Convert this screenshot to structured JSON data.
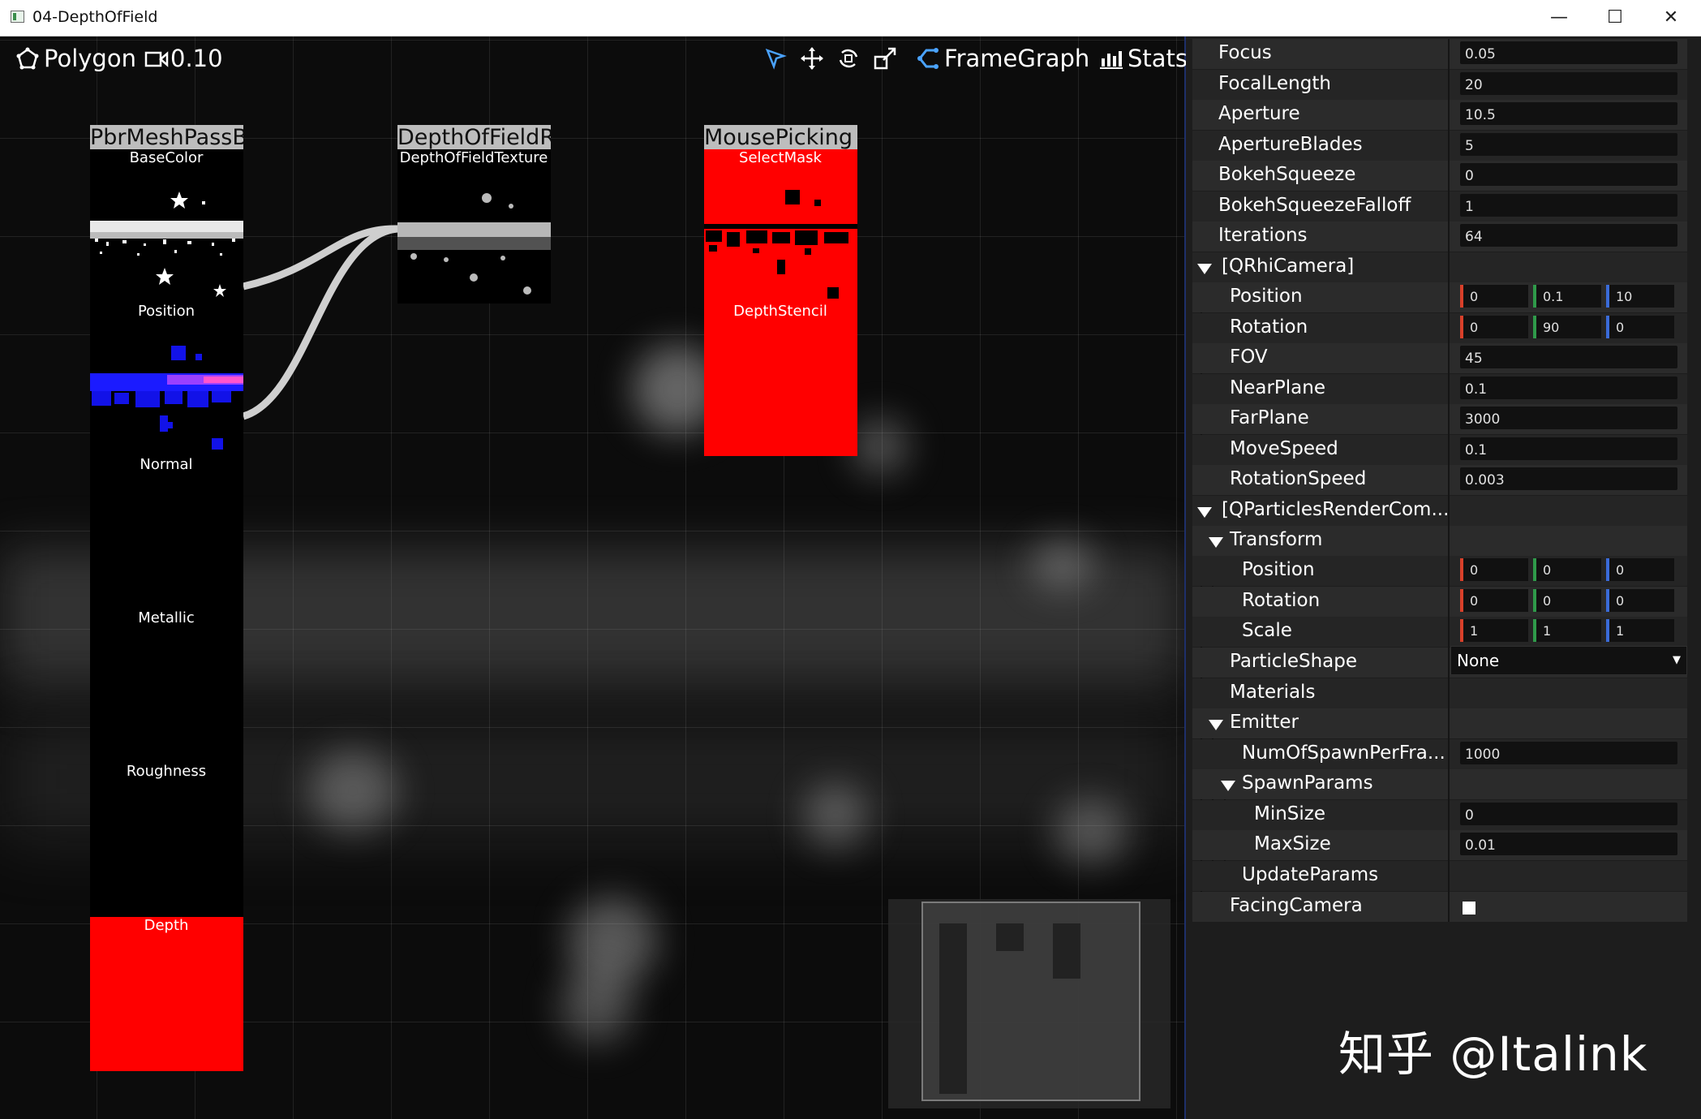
{
  "window": {
    "title": "04-DepthOfField",
    "min": "—",
    "max": "☐",
    "close": "✕"
  },
  "toolbar": {
    "polygon_label": "Polygon",
    "camera_value": "0.10",
    "framegraph_label": "FrameGraph",
    "stats_label": "Stats"
  },
  "nodes": {
    "pbr": {
      "title": "PbrMeshPassB",
      "slots": [
        "BaseColor",
        "Position",
        "Normal",
        "Metallic",
        "Roughness",
        "Depth"
      ]
    },
    "dof": {
      "title": "DepthOfFieldR",
      "slots": [
        "DepthOfFieldTexture"
      ]
    },
    "mouse": {
      "title": "MousePicking",
      "slots": [
        "SelectMask",
        "DepthStencil"
      ]
    }
  },
  "properties": {
    "focus": {
      "label": "Focus",
      "value": "0.05"
    },
    "focal_length": {
      "label": "FocalLength",
      "value": "20"
    },
    "aperture": {
      "label": "Aperture",
      "value": "10.5"
    },
    "aperture_blades": {
      "label": "ApertureBlades",
      "value": "5"
    },
    "bokeh_squeeze": {
      "label": "BokehSqueeze",
      "value": "0"
    },
    "bokeh_falloff": {
      "label": "BokehSqueezeFalloff",
      "value": "1"
    },
    "iterations": {
      "label": "Iterations",
      "value": "64"
    },
    "camera_group": "[QRhiCamera]",
    "cam_position": {
      "label": "Position",
      "x": "0",
      "y": "0.1",
      "z": "10"
    },
    "cam_rotation": {
      "label": "Rotation",
      "x": "0",
      "y": "90",
      "z": "0"
    },
    "fov": {
      "label": "FOV",
      "value": "45"
    },
    "near_plane": {
      "label": "NearPlane",
      "value": "0.1"
    },
    "far_plane": {
      "label": "FarPlane",
      "value": "3000"
    },
    "move_speed": {
      "label": "MoveSpeed",
      "value": "0.1"
    },
    "rotation_speed": {
      "label": "RotationSpeed",
      "value": "0.003"
    },
    "particles_group": "[QParticlesRenderCom...",
    "transform_group": "Transform",
    "tr_position": {
      "label": "Position",
      "x": "0",
      "y": "0",
      "z": "0"
    },
    "tr_rotation": {
      "label": "Rotation",
      "x": "0",
      "y": "0",
      "z": "0"
    },
    "tr_scale": {
      "label": "Scale",
      "x": "1",
      "y": "1",
      "z": "1"
    },
    "particle_shape": {
      "label": "ParticleShape",
      "value": "None"
    },
    "materials": {
      "label": "Materials"
    },
    "emitter_group": "Emitter",
    "num_spawn": {
      "label": "NumOfSpawnPerFra...",
      "value": "1000"
    },
    "spawn_params_group": "SpawnParams",
    "min_size": {
      "label": "MinSize",
      "value": "0"
    },
    "max_size": {
      "label": "MaxSize",
      "value": "0.01"
    },
    "update_params": {
      "label": "UpdateParams"
    },
    "facing_camera": {
      "label": "FacingCamera",
      "checked": true
    }
  },
  "colors": {
    "x_axis": "#d8402a",
    "y_axis": "#2f9a4a",
    "z_axis": "#3a6bd8",
    "accent": "#4aa3ff",
    "slot_red": "#ff0000"
  },
  "watermark": "知乎 @Italink"
}
